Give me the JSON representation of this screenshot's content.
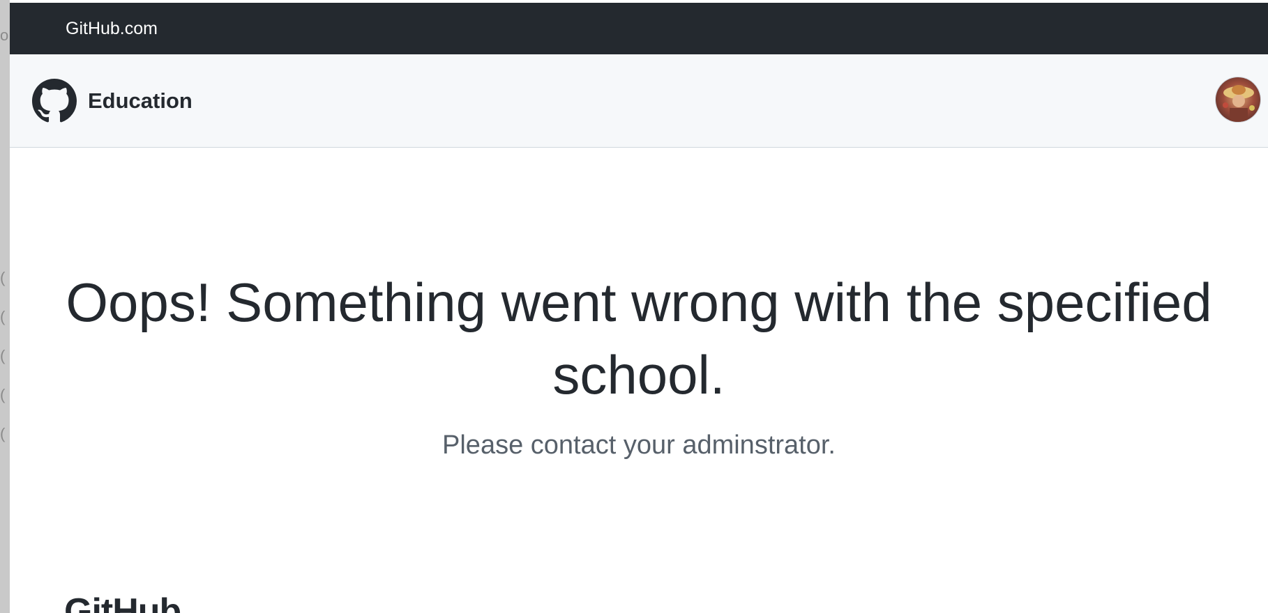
{
  "top_bar": {
    "link_label": "GitHub.com"
  },
  "header": {
    "brand_name": "Education",
    "logo_icon": "github-octocat-icon",
    "avatar_icon": "user-avatar"
  },
  "main": {
    "headline": "Oops! Something went wrong with the specified school.",
    "subtext": "Please contact your adminstrator."
  },
  "footer": {
    "brand": "GitHub"
  },
  "colors": {
    "top_bar_bg": "#24292f",
    "header_bg": "#f6f8fa",
    "text_primary": "#24292f",
    "text_muted": "#57606a"
  }
}
